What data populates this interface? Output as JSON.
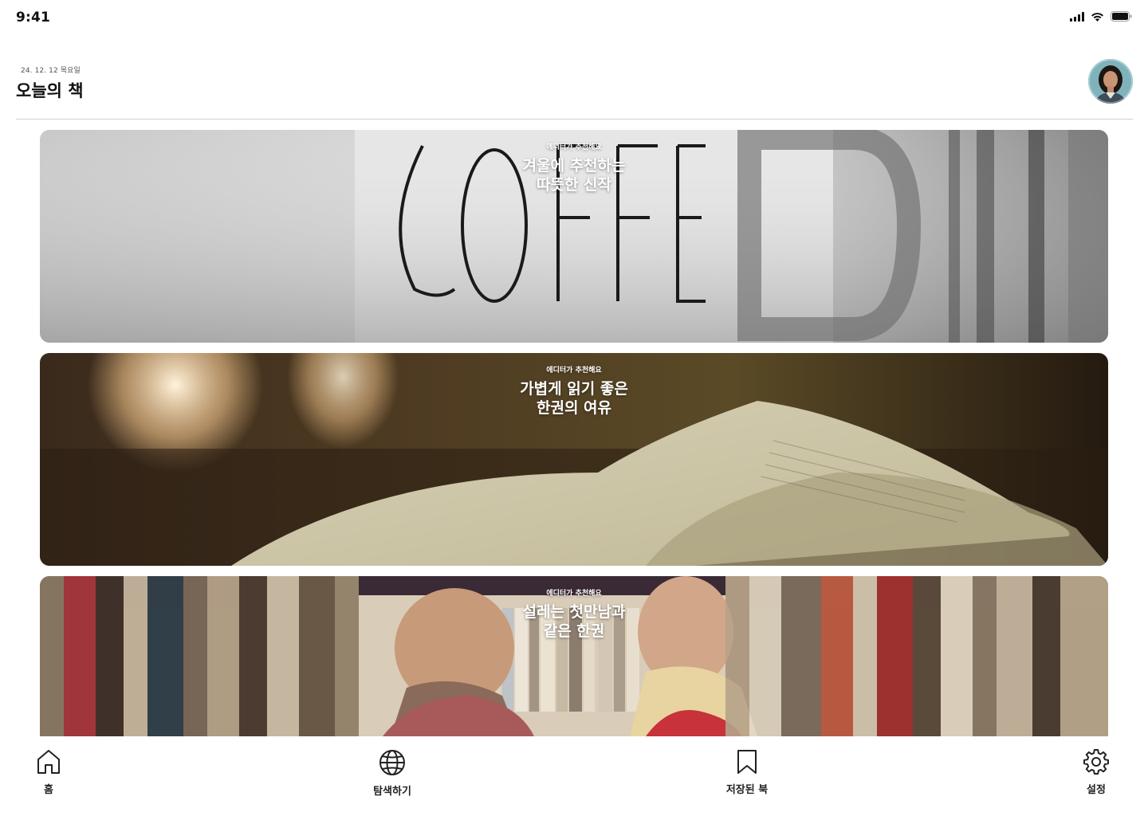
{
  "status_bar": {
    "time": "9:41",
    "icons": [
      "cellular-signal-icon",
      "wifi-icon",
      "battery-icon"
    ]
  },
  "header": {
    "date": "24. 12. 12 목요일",
    "title": "오늘의 책",
    "avatar_icon": "user-avatar"
  },
  "banners": [
    {
      "kicker": "에디터가 추천해요",
      "title": "겨울에 추천하는\n따뜻한 신작",
      "image": "coffee-mug-photo"
    },
    {
      "kicker": "에디터가 추천해요",
      "title": "가볍게 읽기 좋은\n한권의 여유",
      "image": "open-book-photo"
    },
    {
      "kicker": "에디터가 추천해요",
      "title": "설레는 첫만남과\n같은 한권",
      "image": "bookshelf-couple-photo"
    }
  ],
  "tab_bar": {
    "items": [
      {
        "label": "홈",
        "icon": "home-icon"
      },
      {
        "label": "탐색하기",
        "icon": "globe-icon"
      },
      {
        "label": "저장된 북",
        "icon": "bookmark-icon"
      },
      {
        "label": "설정",
        "icon": "gear-icon"
      }
    ]
  },
  "colors": {
    "background": "#ffffff",
    "text": "#111111",
    "divider": "#cfcfcf",
    "banner_text": "#ffffff"
  }
}
